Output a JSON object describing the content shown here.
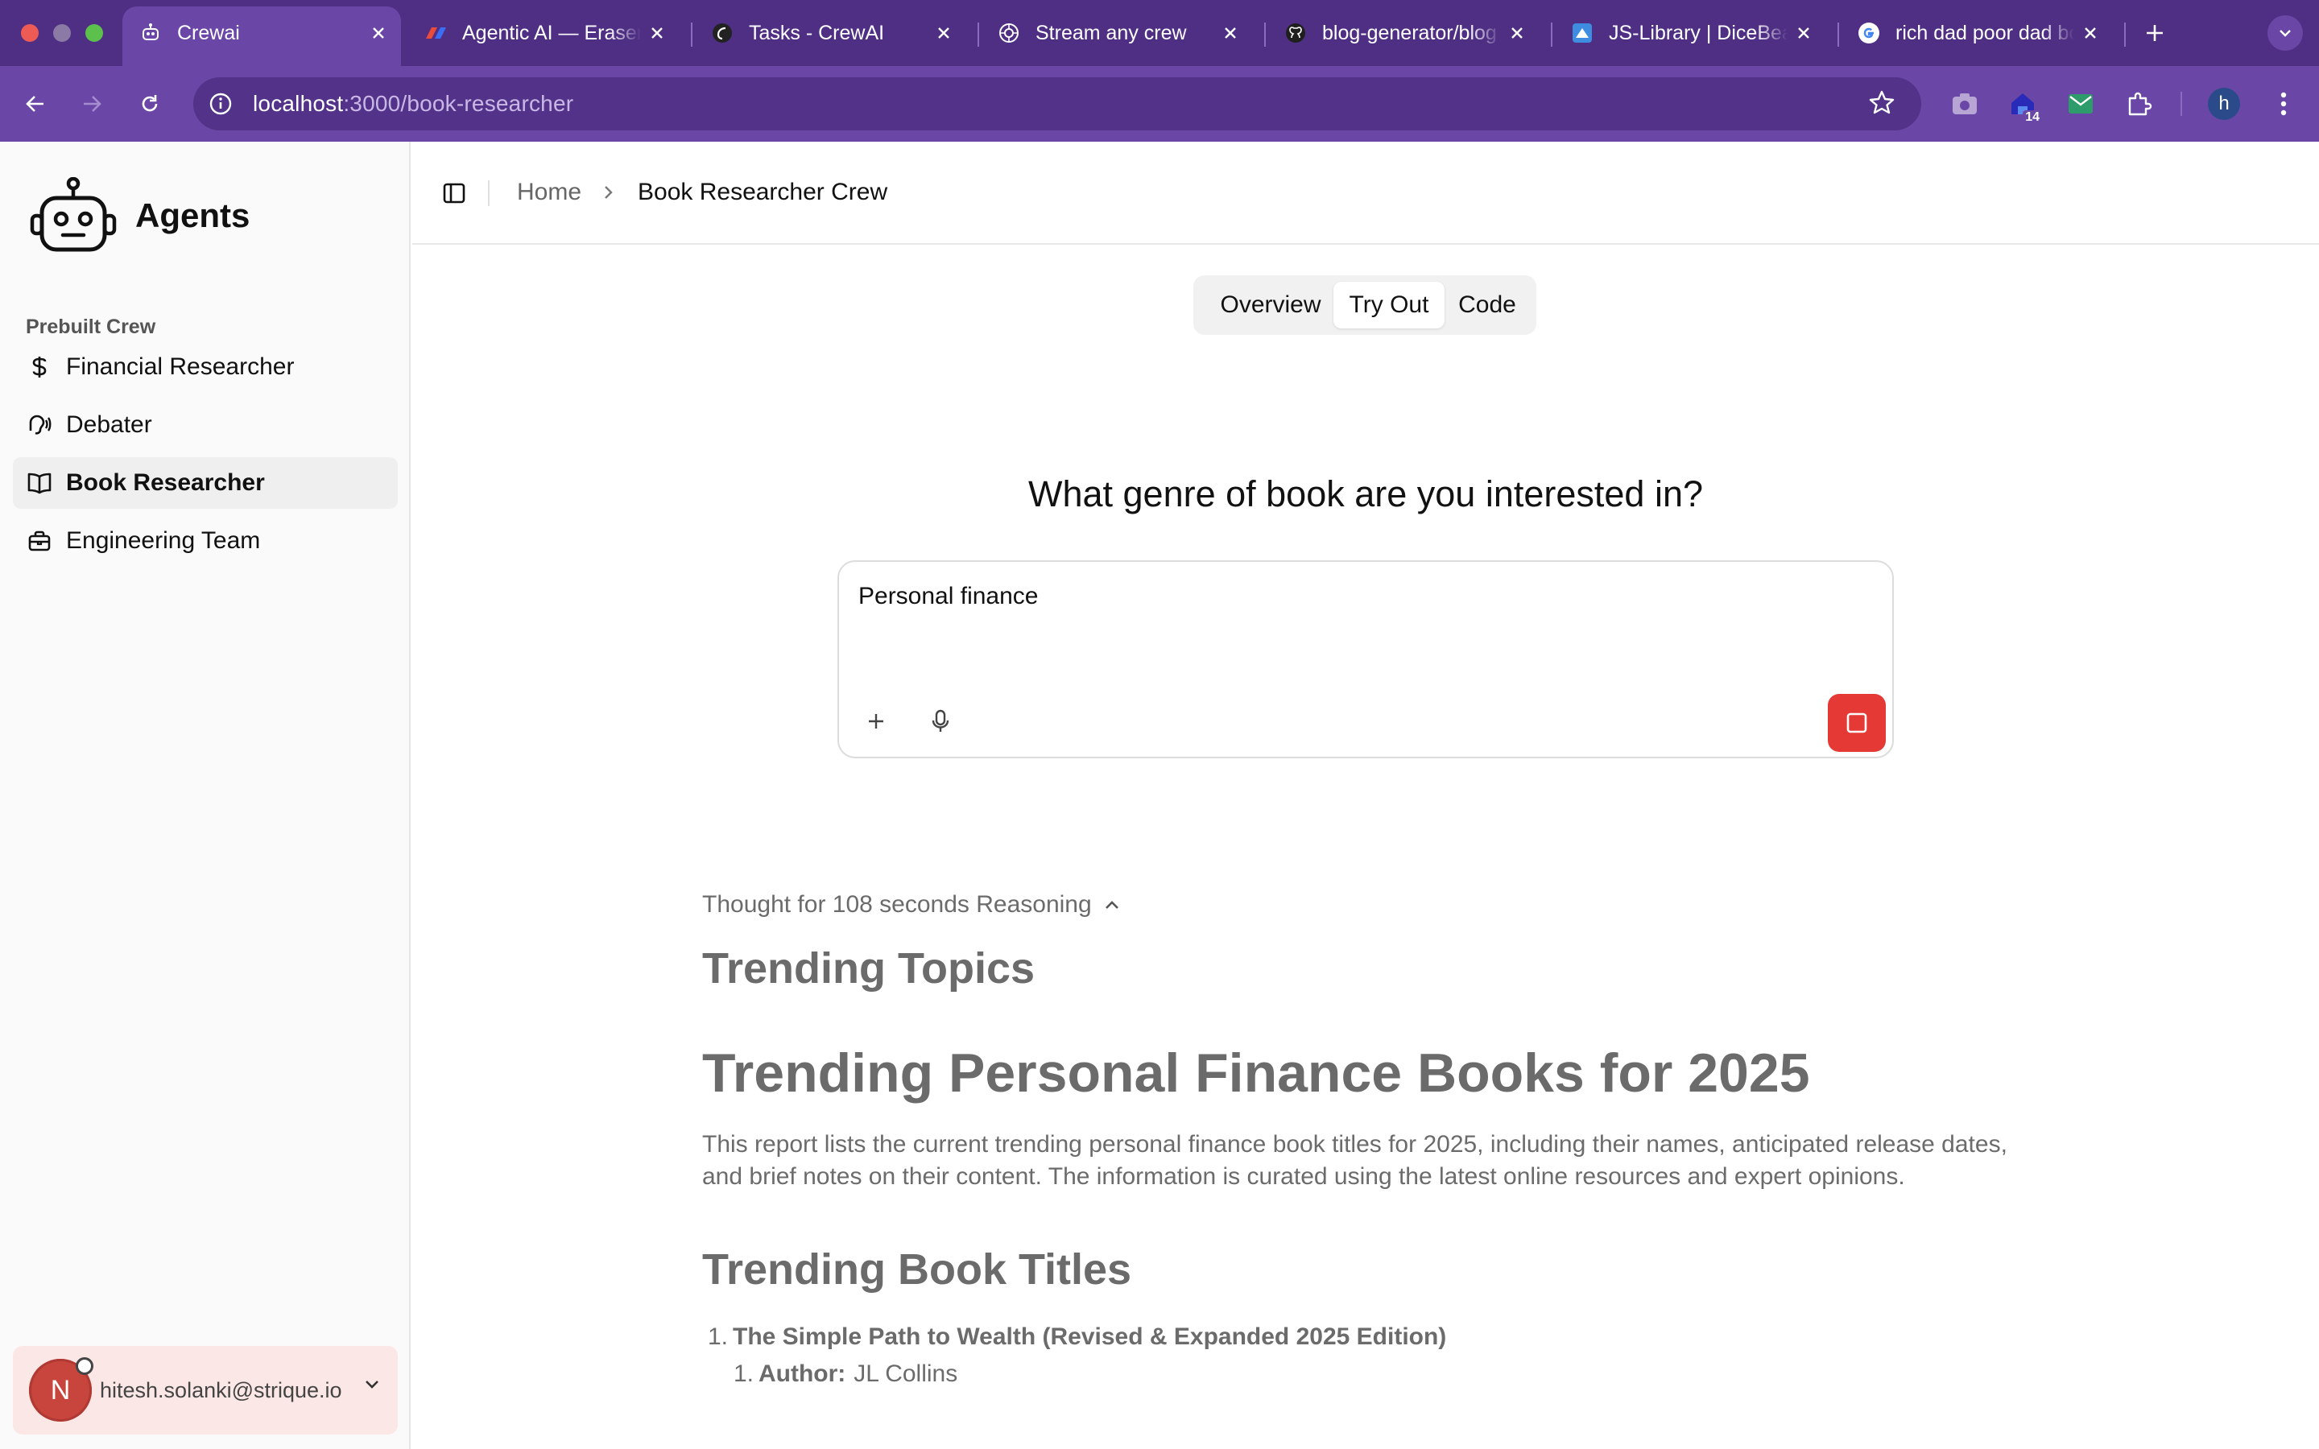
{
  "browser": {
    "tabs": [
      {
        "title": "Crewai",
        "icon": "robot-favicon-icon",
        "active": true
      },
      {
        "title": "Agentic AI — Eraser",
        "icon": "eraser-favicon-icon",
        "active": false
      },
      {
        "title": "Tasks - CrewAI",
        "icon": "crewai-favicon-icon",
        "active": false
      },
      {
        "title": "Stream any crew",
        "icon": "openai-favicon-icon",
        "active": false
      },
      {
        "title": "blog-generator/blog",
        "icon": "github-favicon-icon",
        "active": false
      },
      {
        "title": "JS-Library | DiceBear",
        "icon": "dicebear-favicon-icon",
        "active": false
      },
      {
        "title": "rich dad poor dad book",
        "icon": "google-favicon-icon",
        "active": false
      }
    ],
    "url_host": "localhost",
    "url_path": ":3000/book-researcher",
    "extension_badge": "14",
    "profile_initial": "h",
    "colors": {
      "frame": "#4f2f84",
      "toolbar": "#6a46a6",
      "omnibox": "#533289"
    }
  },
  "sidebar": {
    "brand": "Agents",
    "section_label": "Prebuilt Crew",
    "items": [
      {
        "label": "Financial Researcher",
        "icon": "dollar-icon"
      },
      {
        "label": "Debater",
        "icon": "debate-icon"
      },
      {
        "label": "Book Researcher",
        "icon": "book-icon",
        "active": true
      },
      {
        "label": "Engineering Team",
        "icon": "briefcase-icon"
      }
    ],
    "user": {
      "initial": "N",
      "email": "hitesh.solanki@strique.io"
    }
  },
  "header": {
    "breadcrumb_home": "Home",
    "breadcrumb_current": "Book Researcher Crew"
  },
  "tabs": [
    {
      "label": "Overview",
      "active": false
    },
    {
      "label": "Try Out",
      "active": true
    },
    {
      "label": "Code",
      "active": false
    }
  ],
  "prompt": {
    "question": "What genre of book are you interested in?",
    "input_value": "Personal finance",
    "stop_color": "#e53935"
  },
  "output": {
    "thought_label": "Thought for 108 seconds Reasoning",
    "heading_topics": "Trending Topics",
    "heading_report": "Trending Personal Finance Books for 2025",
    "paragraph": "This report lists the current trending personal finance book titles for 2025, including their names, anticipated release dates, and brief notes on their content. The information is curated using the latest online resources and expert opinions.",
    "heading_titles": "Trending Book Titles",
    "list": [
      {
        "number": "1.",
        "title": "The Simple Path to Wealth (Revised & Expanded 2025 Edition)",
        "sub": [
          {
            "number": "1.",
            "label": "Author:",
            "value": "JL Collins"
          }
        ]
      }
    ]
  }
}
